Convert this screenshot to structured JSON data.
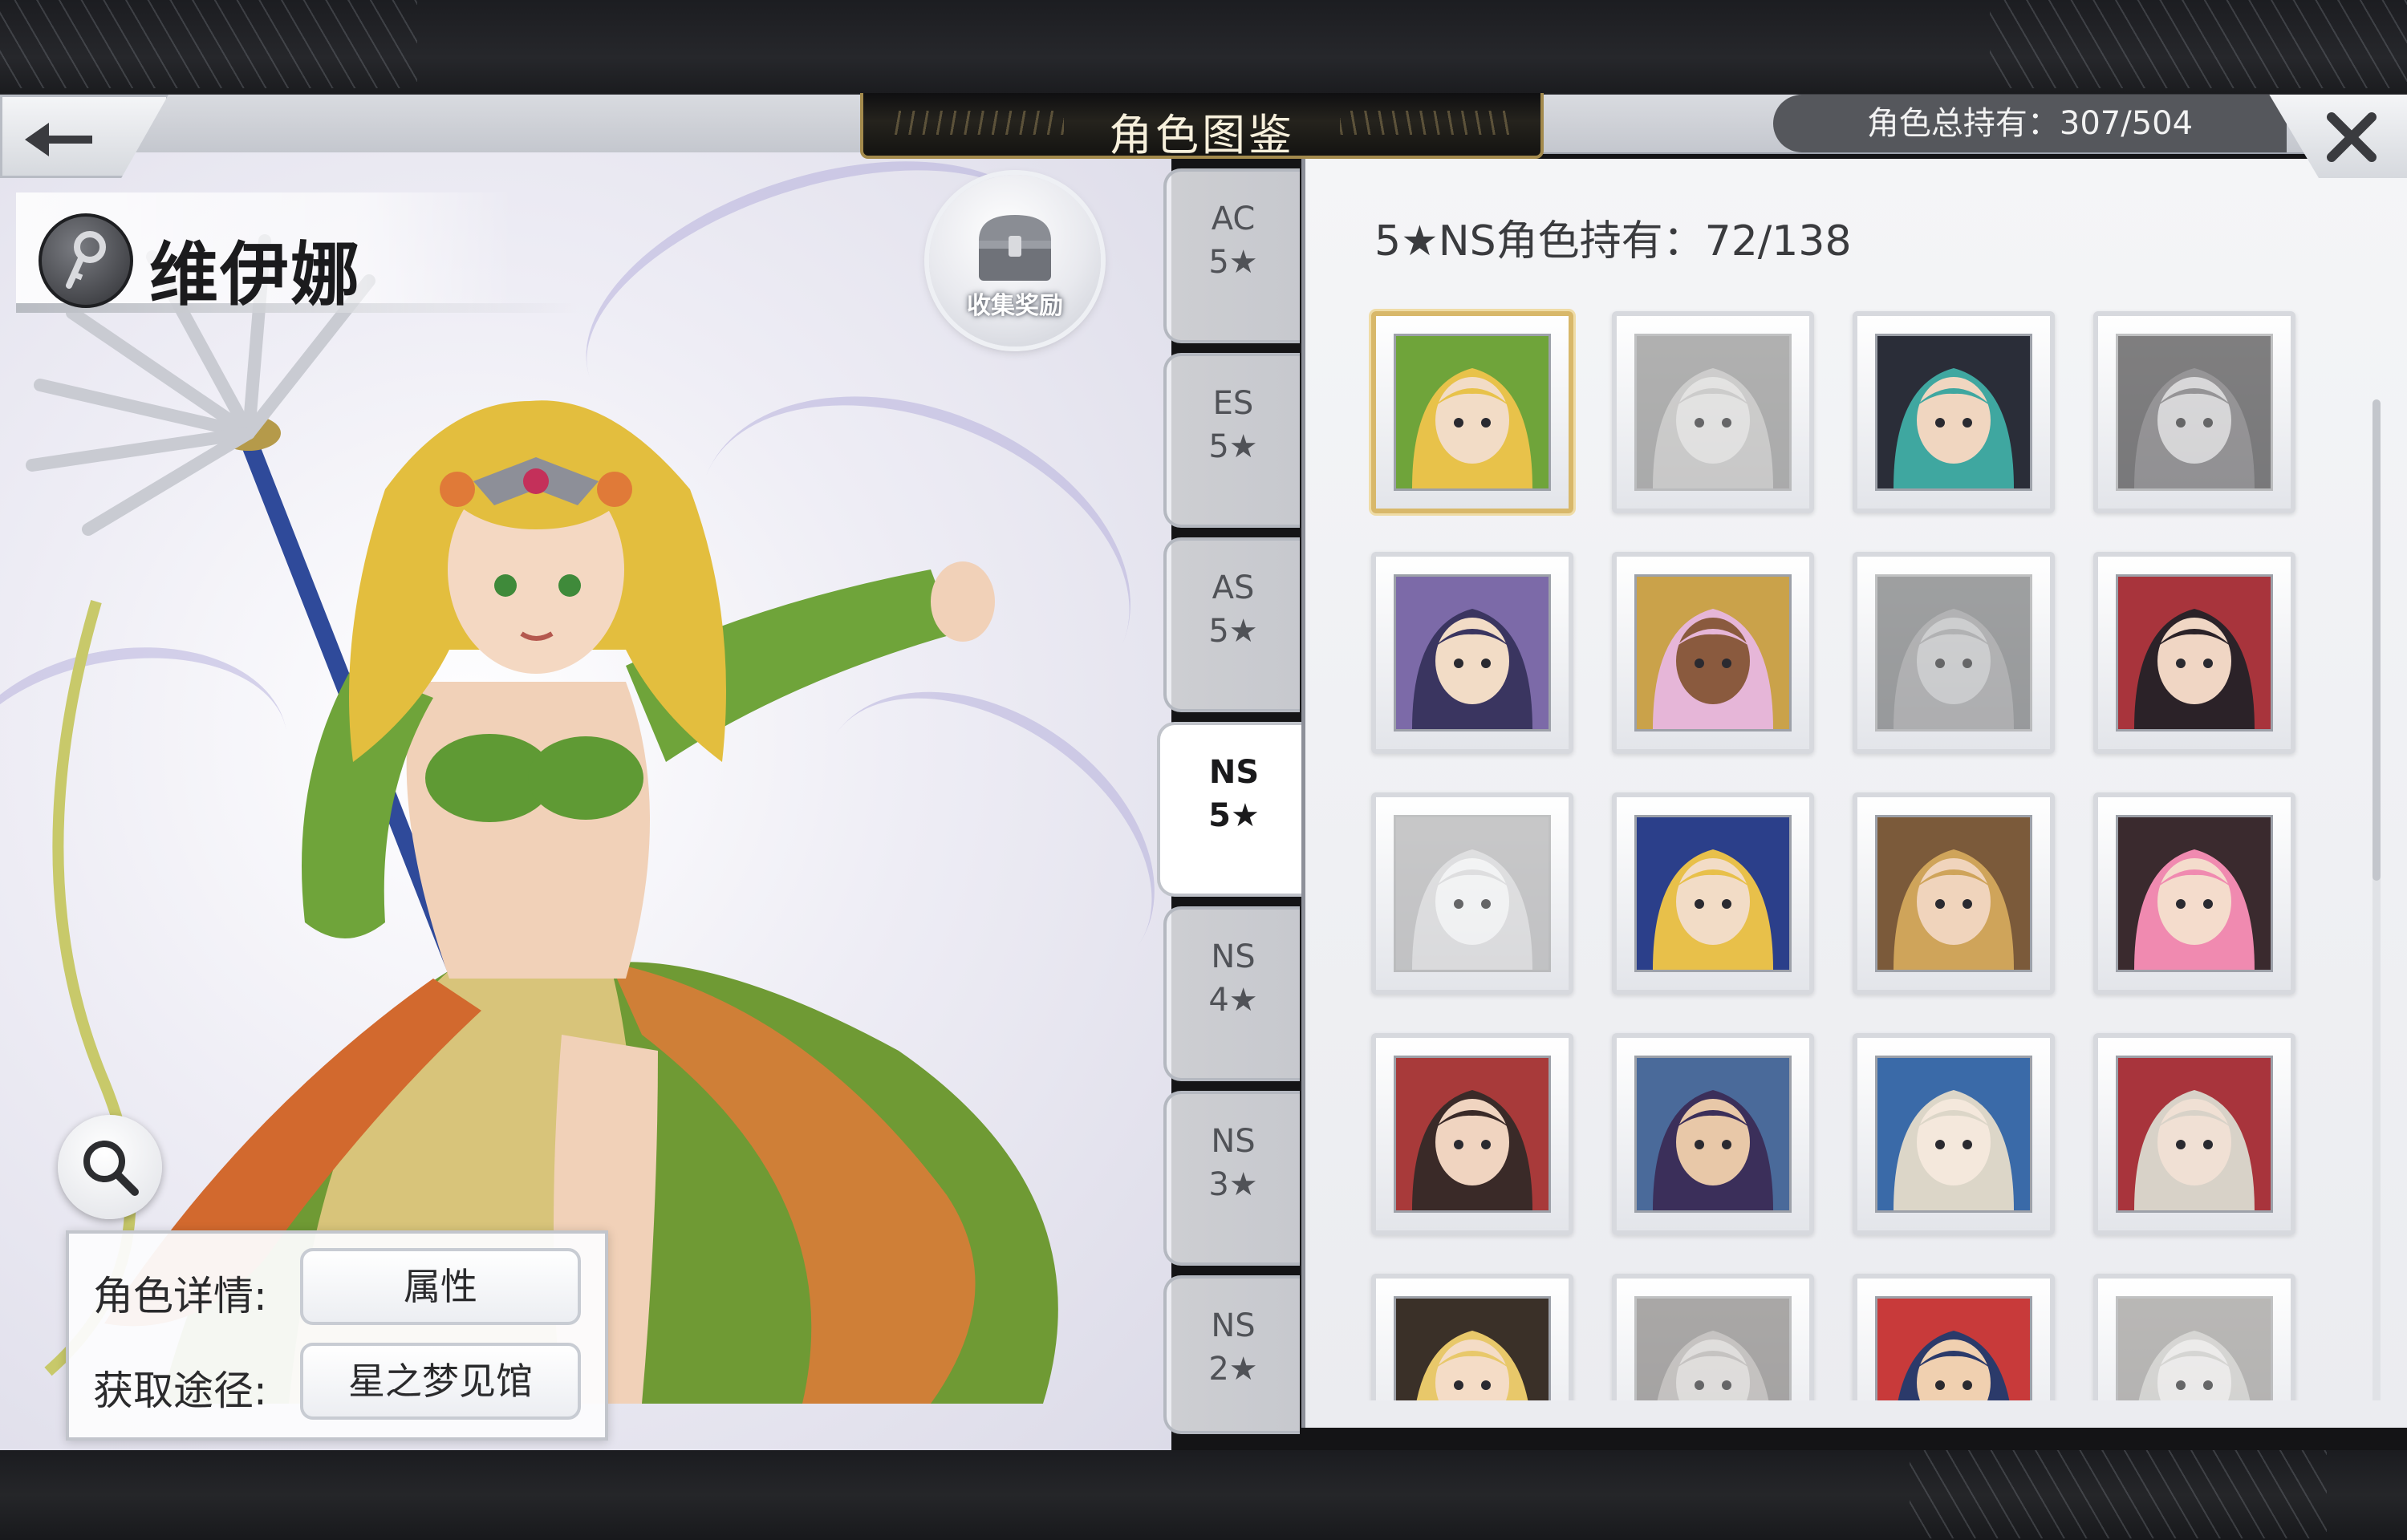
{
  "header": {
    "title": "角色图鉴",
    "owned_total": "角色总持有：307/504"
  },
  "character": {
    "name": "维伊娜",
    "reward_label": "收集奖励",
    "details_label": "角色详情:",
    "details_value": "属性",
    "source_label": "获取途径:",
    "source_value": "星之梦见馆"
  },
  "tabs": [
    {
      "type": "AC",
      "stars": "5★",
      "active": false
    },
    {
      "type": "ES",
      "stars": "5★",
      "active": false
    },
    {
      "type": "AS",
      "stars": "5★",
      "active": false
    },
    {
      "type": "NS",
      "stars": "5★",
      "active": true
    },
    {
      "type": "NS",
      "stars": "4★",
      "active": false
    },
    {
      "type": "NS",
      "stars": "3★",
      "active": false
    },
    {
      "type": "NS",
      "stars": "2★",
      "active": false
    }
  ],
  "roster": {
    "heading": "5★NS角色持有：72/138"
  },
  "colors": {
    "accent_gold": "#d8b86a",
    "title_bg": "#1b1a17",
    "panel_bg": "#f4f5f7"
  },
  "icons": [
    "back-arrow-icon",
    "close-icon",
    "key-icon",
    "treasure-chest-icon",
    "magnifier-icon"
  ]
}
